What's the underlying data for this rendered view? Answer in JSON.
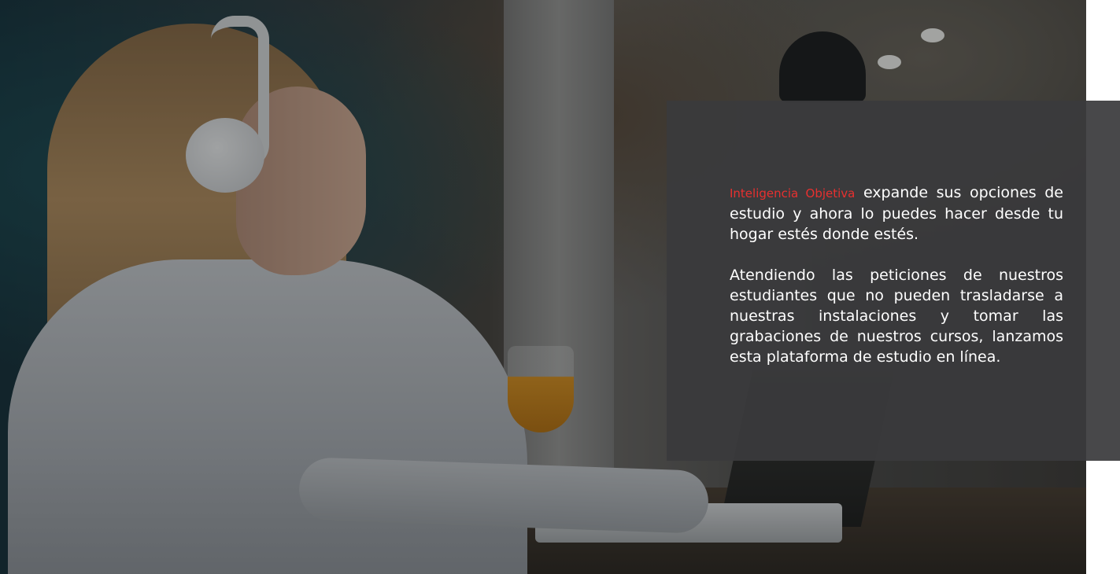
{
  "hero": {
    "photo_description_icon": "woman-headphones-laptop-photo"
  },
  "info": {
    "brand": "Inteligencia Objetiva",
    "paragraph1_rest": " expande sus opciones de estudio y ahora lo puedes hacer desde tu hogar estés donde estés.",
    "paragraph2": "Atendiendo las peticiones de nuestros estudiantes que no pueden trasladarse a nuestras instalaciones y tomar las grabaciones de nuestros cursos, lanzamos esta plataforma de estudio en línea."
  },
  "colors": {
    "brand_accent": "#e8302f",
    "panel_background": "#3a3a3c",
    "text": "#ffffff"
  }
}
